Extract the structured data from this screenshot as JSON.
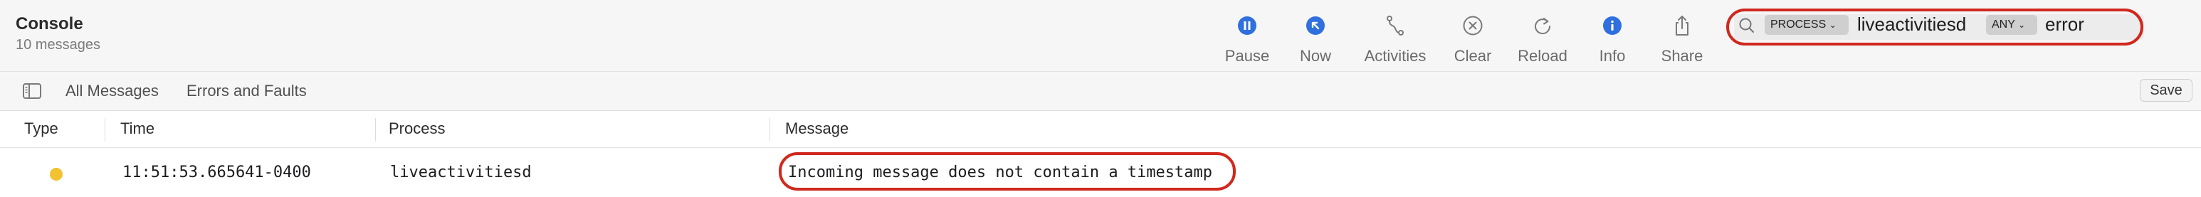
{
  "header": {
    "title": "Console",
    "subtitle": "10 messages"
  },
  "toolbar": {
    "pause": "Pause",
    "now": "Now",
    "activities": "Activities",
    "clear": "Clear",
    "reload": "Reload",
    "info": "Info",
    "share": "Share"
  },
  "search": {
    "token1_type": "PROCESS",
    "token1_value": "liveactivitiesd",
    "token2_type": "ANY",
    "token2_value": "error"
  },
  "filters": {
    "all_messages": "All Messages",
    "errors_and_faults": "Errors and Faults",
    "save": "Save"
  },
  "table": {
    "columns": [
      "Type",
      "Time",
      "Process",
      "Message"
    ],
    "rows": [
      {
        "type_color": "#f2c230",
        "time": "11:51:53.665641-0400",
        "process": "liveactivitiesd",
        "message": "Incoming message does not contain a timestamp"
      }
    ]
  },
  "colors": {
    "accent": "#2f6fde",
    "highlight": "#d0281d",
    "warning_dot": "#f2c230"
  }
}
